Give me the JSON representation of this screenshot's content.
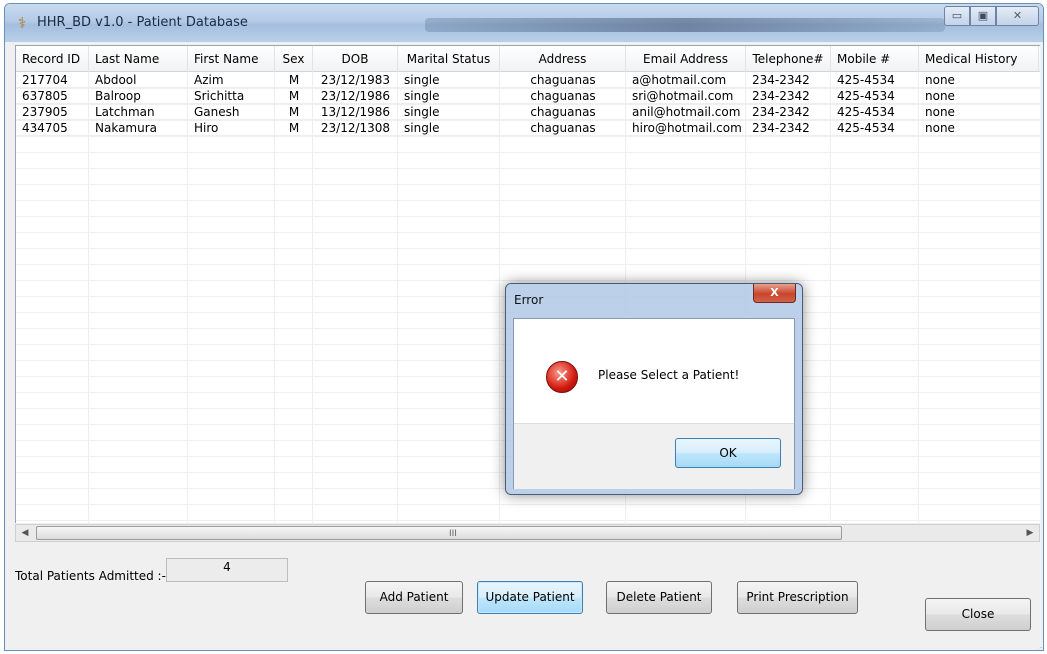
{
  "window": {
    "title": "HHR_BD v1.0 - Patient Database",
    "min_glyph": "▭",
    "max_glyph": "▣",
    "close_glyph": "✕"
  },
  "grid": {
    "columns": [
      "Record ID",
      "Last Name",
      "First Name",
      "Sex",
      "DOB",
      "Marital Status",
      "Address",
      "Email Address",
      "Telephone#",
      "Mobile #",
      "Medical History"
    ],
    "rows": [
      [
        "217704",
        "Abdool",
        "Azim",
        "M",
        "23/12/1983",
        "single",
        "chaguanas",
        "a@hotmail.com",
        "234-2342",
        "425-4534",
        "none"
      ],
      [
        "637805",
        "Balroop",
        "Srichitta",
        "M",
        "23/12/1986",
        "single",
        "chaguanas",
        "sri@hotmail.com",
        "234-2342",
        "425-4534",
        "none"
      ],
      [
        "237905",
        "Latchman",
        "Ganesh",
        "M",
        "13/12/1986",
        "single",
        "chaguanas",
        "anil@hotmail.com",
        "234-2342",
        "425-4534",
        "none"
      ],
      [
        "434705",
        "Nakamura",
        "Hiro",
        "M",
        "23/12/1308",
        "single",
        "chaguanas",
        "hiro@hotmail.com",
        "234-2342",
        "425-4534",
        "none"
      ]
    ]
  },
  "scrollbar": {
    "left_arrow": "◀",
    "right_arrow": "▶",
    "grip": "III"
  },
  "footer": {
    "total_label": "Total Patients Admitted :-",
    "total_value": "4",
    "buttons": {
      "add": "Add Patient",
      "update": "Update Patient",
      "delete": "Delete Patient",
      "print": "Print Prescription",
      "close": "Close"
    }
  },
  "dialog": {
    "title": "Error",
    "close_glyph": "X",
    "icon_glyph": "✕",
    "message": "Please Select a Patient!",
    "ok": "OK"
  }
}
